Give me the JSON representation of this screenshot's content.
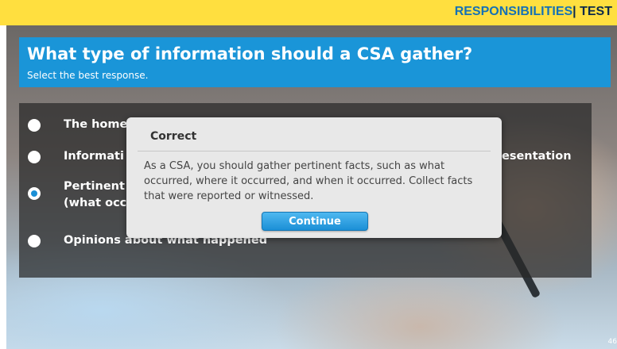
{
  "header": {
    "section": "RESPONSIBILITIES",
    "separator": "|",
    "mode": "TEST"
  },
  "question": {
    "title": "What type of information should a CSA gather?",
    "instruction": "Select the best response."
  },
  "options": [
    {
      "text": "The home",
      "selected": false
    },
    {
      "text": "Informati",
      "text_right": "esentation",
      "selected": false
    },
    {
      "line1": "Pertinent",
      "line2": "(what occu",
      "selected": true
    },
    {
      "text": "Opinions about what happened",
      "selected": false
    }
  ],
  "dialog": {
    "title": "Correct",
    "message": "As a CSA, you should gather pertinent facts, such as what occurred, where it occurred, and when it occurred. Collect facts that were reported or witnessed.",
    "button_label": "Continue"
  },
  "page_number": "46",
  "colors": {
    "topbar": "#ffdf3f",
    "banner": "#1a95d8",
    "section_text": "#1571b5",
    "button": "#1b8fd6"
  }
}
